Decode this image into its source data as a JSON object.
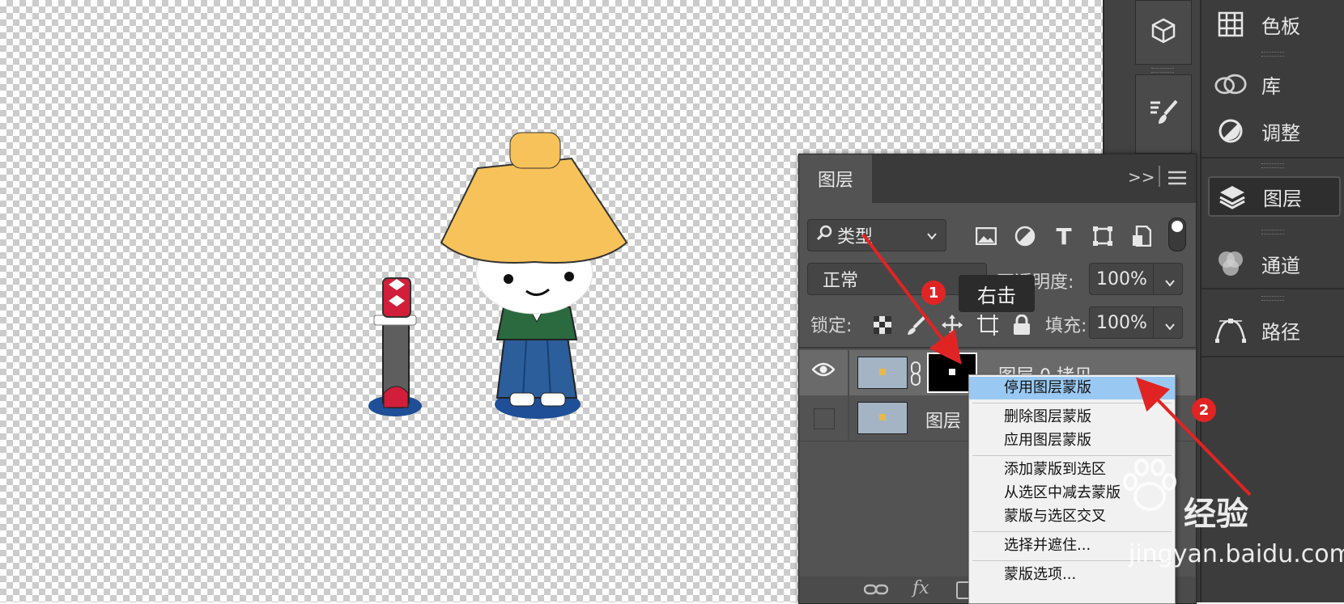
{
  "dock_panels": [
    {
      "label": "色板",
      "icon": "swatches-grid-icon"
    },
    {
      "label": "库",
      "icon": "libraries-cloud-icon"
    },
    {
      "label": "调整",
      "icon": "adjustments-circle-icon"
    },
    {
      "label": "图层",
      "icon": "layers-stack-icon",
      "active": true
    },
    {
      "label": "通道",
      "icon": "channels-circles-icon"
    },
    {
      "label": "路径",
      "icon": "paths-pen-icon"
    }
  ],
  "layers_panel": {
    "tab_label": "图层",
    "filter_kind": "类型",
    "blend_mode": "正常",
    "opacity_label": "不透明度:",
    "opacity_value": "100%",
    "lock_label": "锁定:",
    "fill_label": "填充:",
    "fill_value": "100%",
    "layers": [
      {
        "name": "图层 0 拷贝",
        "visible": true,
        "has_mask": true
      },
      {
        "name": "图层",
        "visible": false,
        "has_mask": false
      }
    ]
  },
  "context_menu": {
    "items": [
      {
        "label": "停用图层蒙版",
        "highlighted": true
      },
      {
        "label": "删除图层蒙版"
      },
      {
        "label": "应用图层蒙版"
      },
      {
        "label": "添加蒙版到选区"
      },
      {
        "label": "从选区中减去蒙版"
      },
      {
        "label": "蒙版与选区交叉"
      },
      {
        "label": "选择并遮住..."
      },
      {
        "label": "蒙版选项..."
      }
    ]
  },
  "annotations": {
    "step1": "1",
    "step2": "2",
    "tooltip": "右击",
    "arrow_color": "#e02424"
  },
  "watermark": {
    "brand": "经验",
    "url": "jingyan.baidu.com"
  },
  "colors": {
    "panel_bg": "#535353",
    "menu_highlight": "#99c9f2",
    "hat": "#f7c25a",
    "robe_blue": "#2c5e9c",
    "robe_green": "#2a6a3e"
  }
}
